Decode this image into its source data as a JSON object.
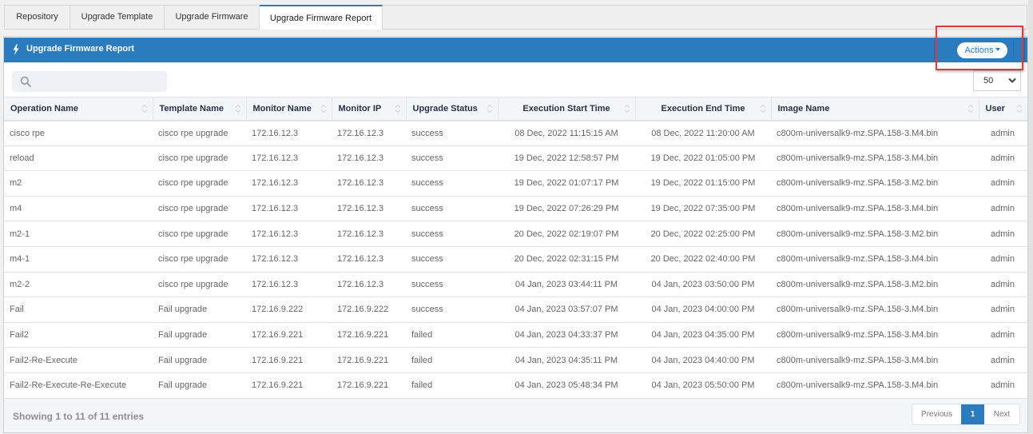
{
  "tabs": [
    {
      "label": "Repository",
      "active": false
    },
    {
      "label": "Upgrade Template",
      "active": false
    },
    {
      "label": "Upgrade Firmware",
      "active": false
    },
    {
      "label": "Upgrade Firmware Report",
      "active": true
    }
  ],
  "panel": {
    "title": "Upgrade Firmware Report",
    "title_icon": "bolt-icon",
    "actions_label": "Actions",
    "highlight_color": "#e0393e",
    "header_color": "#2b7bbf"
  },
  "search": {
    "placeholder": "",
    "value": "",
    "icon": "search-icon"
  },
  "page_size": {
    "selected": "50"
  },
  "table": {
    "columns": [
      {
        "label": "Operation Name"
      },
      {
        "label": "Template Name"
      },
      {
        "label": "Monitor Name"
      },
      {
        "label": "Monitor IP"
      },
      {
        "label": "Upgrade Status"
      },
      {
        "label": "Execution Start Time"
      },
      {
        "label": "Execution End Time"
      },
      {
        "label": "Image Name"
      },
      {
        "label": "User"
      }
    ],
    "rows": [
      [
        "cisco rpe",
        "cisco rpe upgrade",
        "172.16.12.3",
        "172.16.12.3",
        "success",
        "08 Dec, 2022 11:15:15 AM",
        "08 Dec, 2022 11:20:00 AM",
        "c800m-universalk9-mz.SPA.158-3.M4.bin",
        "admin"
      ],
      [
        "reload",
        "cisco rpe upgrade",
        "172.16.12.3",
        "172.16.12.3",
        "success",
        "19 Dec, 2022 12:58:57 PM",
        "19 Dec, 2022 01:05:00 PM",
        "c800m-universalk9-mz.SPA.158-3.M4.bin",
        "admin"
      ],
      [
        "m2",
        "cisco rpe upgrade",
        "172.16.12.3",
        "172.16.12.3",
        "success",
        "19 Dec, 2022 01:07:17 PM",
        "19 Dec, 2022 01:15:00 PM",
        "c800m-universalk9-mz.SPA.158-3.M2.bin",
        "admin"
      ],
      [
        "m4",
        "cisco rpe upgrade",
        "172.16.12.3",
        "172.16.12.3",
        "success",
        "19 Dec, 2022 07:26:29 PM",
        "19 Dec, 2022 07:35:00 PM",
        "c800m-universalk9-mz.SPA.158-3.M4.bin",
        "admin"
      ],
      [
        "m2-1",
        "cisco rpe upgrade",
        "172.16.12.3",
        "172.16.12.3",
        "success",
        "20 Dec, 2022 02:19:07 PM",
        "20 Dec, 2022 02:25:00 PM",
        "c800m-universalk9-mz.SPA.158-3.M2.bin",
        "admin"
      ],
      [
        "m4-1",
        "cisco rpe upgrade",
        "172.16.12.3",
        "172.16.12.3",
        "success",
        "20 Dec, 2022 02:31:15 PM",
        "20 Dec, 2022 02:40:00 PM",
        "c800m-universalk9-mz.SPA.158-3.M4.bin",
        "admin"
      ],
      [
        "m2-2",
        "cisco rpe upgrade",
        "172.16.12.3",
        "172.16.12.3",
        "success",
        "04 Jan, 2023 03:44:11 PM",
        "04 Jan, 2023 03:50:00 PM",
        "c800m-universalk9-mz.SPA.158-3.M2.bin",
        "admin"
      ],
      [
        "Fail",
        "Fail upgrade",
        "172.16.9.222",
        "172.16.9.222",
        "success",
        "04 Jan, 2023 03:57:07 PM",
        "04 Jan, 2023 04:00:00 PM",
        "c800m-universalk9-mz.SPA.158-3.M4.bin",
        "admin"
      ],
      [
        "Fail2",
        "Fail upgrade",
        "172.16.9.221",
        "172.16.9.221",
        "failed",
        "04 Jan, 2023 04:33:37 PM",
        "04 Jan, 2023 04:35:00 PM",
        "c800m-universalk9-mz.SPA.158-3.M4.bin",
        "admin"
      ],
      [
        "Fail2-Re-Execute",
        "Fail upgrade",
        "172.16.9.221",
        "172.16.9.221",
        "failed",
        "04 Jan, 2023 04:35:11 PM",
        "04 Jan, 2023 04:40:00 PM",
        "c800m-universalk9-mz.SPA.158-3.M4.bin",
        "admin"
      ],
      [
        "Fail2-Re-Execute-Re-Execute",
        "Fail upgrade",
        "172.16.9.221",
        "172.16.9.221",
        "failed",
        "04 Jan, 2023 05:48:34 PM",
        "04 Jan, 2023 05:50:00 PM",
        "c800m-universalk9-mz.SPA.158-3.M4.bin",
        "admin"
      ]
    ]
  },
  "footer": {
    "info": "Showing 1 to 11 of 11 entries",
    "pagination": {
      "previous_label": "Previous",
      "current_page": "1",
      "next_label": "Next"
    }
  }
}
